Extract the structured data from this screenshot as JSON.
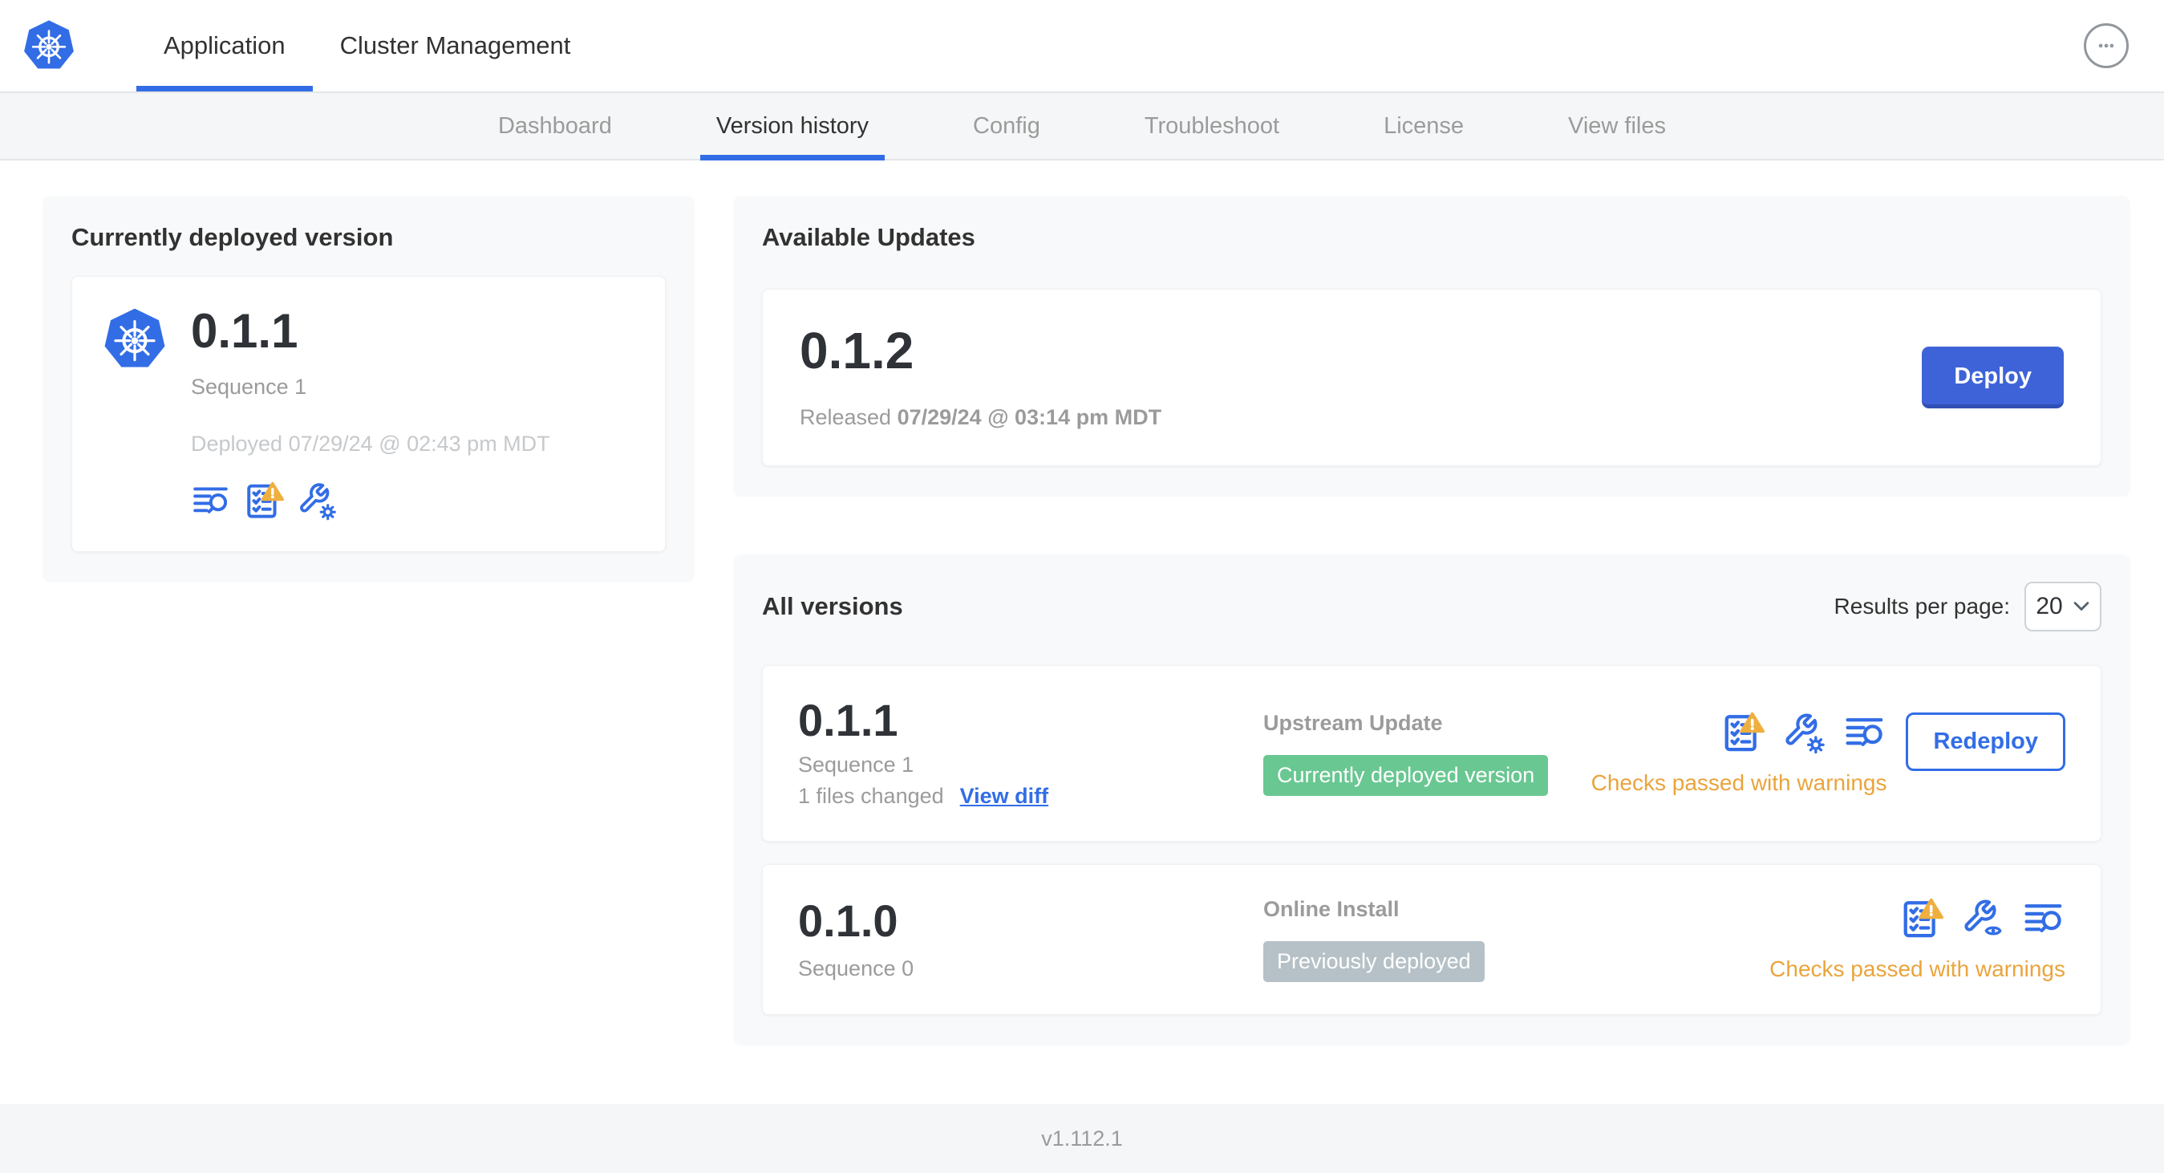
{
  "header": {
    "tabs": [
      {
        "label": "Application"
      },
      {
        "label": "Cluster Management"
      }
    ]
  },
  "subnav": {
    "tabs": [
      {
        "label": "Dashboard"
      },
      {
        "label": "Version history"
      },
      {
        "label": "Config"
      },
      {
        "label": "Troubleshoot"
      },
      {
        "label": "License"
      },
      {
        "label": "View files"
      }
    ]
  },
  "current_version": {
    "title": "Currently deployed version",
    "version": "0.1.1",
    "sequence": "Sequence 1",
    "deployed_prefix": "Deployed",
    "deployed_timestamp": "07/29/24 @ 02:43 pm MDT"
  },
  "available_updates": {
    "title": "Available Updates",
    "version": "0.1.2",
    "released_prefix": "Released",
    "released_timestamp": "07/29/24 @ 03:14 pm MDT",
    "deploy_label": "Deploy"
  },
  "all_versions": {
    "title": "All versions",
    "results_per_page_label": "Results per page:",
    "results_per_page_value": "20",
    "rows": [
      {
        "version": "0.1.1",
        "sequence": "Sequence 1",
        "files_changed": "1 files changed",
        "view_diff_label": "View diff",
        "source": "Upstream Update",
        "badge_label": "Currently deployed version",
        "badge_type": "success",
        "status_text": "Checks passed with warnings",
        "action_label": "Redeploy"
      },
      {
        "version": "0.1.0",
        "sequence": "Sequence 0",
        "source": "Online Install",
        "badge_label": "Previously deployed",
        "badge_type": "muted",
        "status_text": "Checks passed with warnings"
      }
    ]
  },
  "footer": {
    "console_version": "v1.112.1"
  },
  "colors": {
    "accent_blue": "#326de6",
    "success_green": "#69c792",
    "muted_badge_gray": "#b6c1c7",
    "warning_amber": "#eaa43c"
  }
}
